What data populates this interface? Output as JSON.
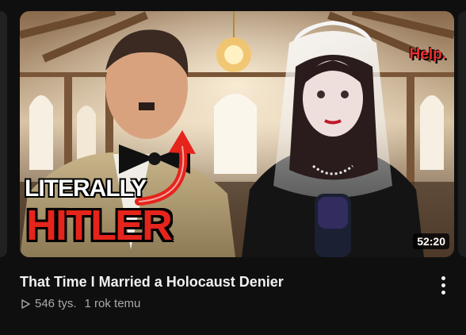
{
  "video": {
    "title": "That Time I Married a Holocaust Denier",
    "views": "546 tys.",
    "age": "1 rok temu",
    "duration": "52:20",
    "thumbnail": {
      "left_caption_line1": "LITERALLY",
      "left_caption_line2": "HITLER",
      "corner_caption": "Help."
    }
  },
  "icons": {
    "views": "play-outline-icon",
    "menu": "more-vertical-icon"
  },
  "colors": {
    "background": "#0f0f0f",
    "title": "#f1f1f1",
    "meta": "#aaaaaa",
    "caption_red": "#e5241c",
    "duration_bg": "#000000"
  }
}
